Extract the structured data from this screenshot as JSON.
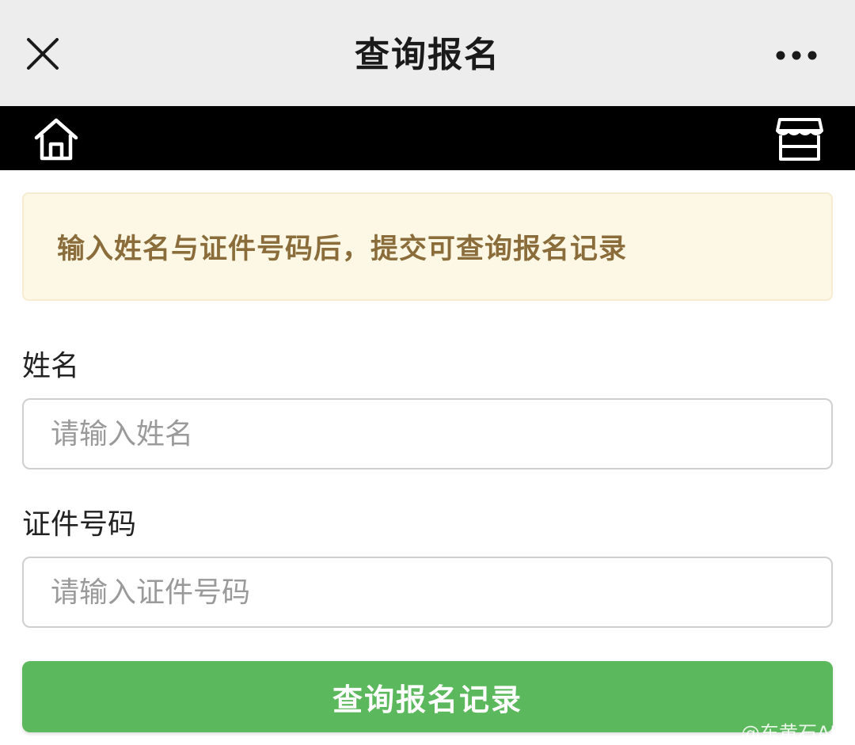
{
  "window": {
    "title": "查询报名",
    "close_icon": "close-icon",
    "more_icon": "more-icon"
  },
  "nav": {
    "home_icon": "home-icon",
    "store_icon": "store-icon"
  },
  "notice": {
    "text": "输入姓名与证件号码后，提交可查询报名记录"
  },
  "form": {
    "name_label": "姓名",
    "name_placeholder": "请输入姓名",
    "name_value": "",
    "id_label": "证件号码",
    "id_placeholder": "请输入证件号码",
    "id_value": "",
    "submit_label": "查询报名记录"
  },
  "watermark": "@东黄石AI",
  "colors": {
    "title_bar_bg": "#ededed",
    "nav_bar_bg": "#000000",
    "notice_bg": "#fcf8e5",
    "notice_text": "#8a6d3b",
    "submit_bg": "#5cb85c"
  }
}
